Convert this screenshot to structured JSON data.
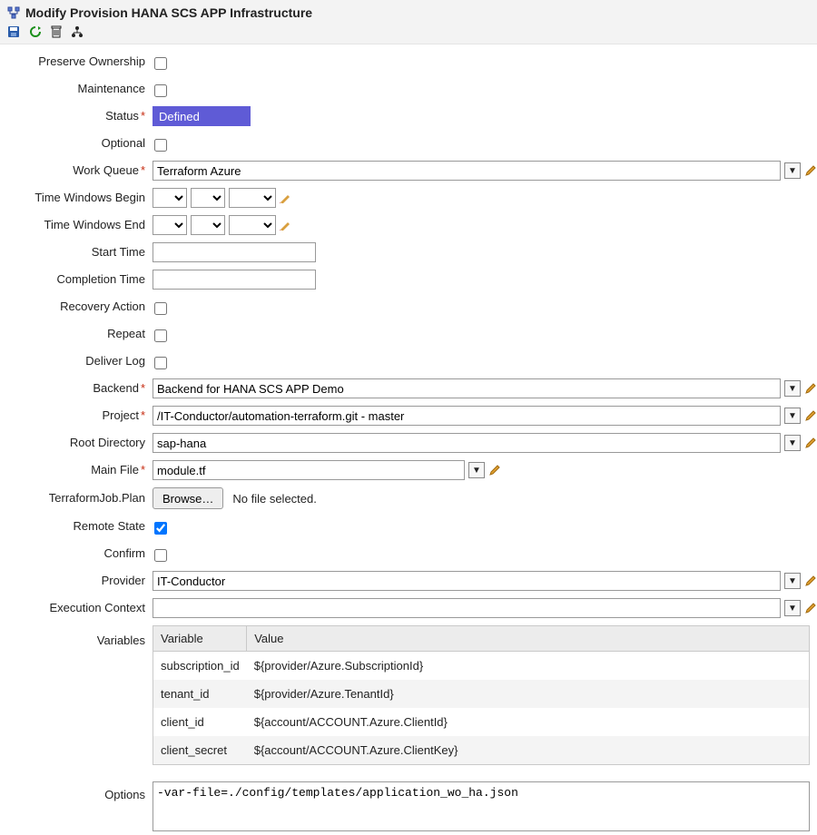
{
  "header": {
    "title": "Modify Provision HANA SCS APP Infrastructure"
  },
  "fields": {
    "preserve_ownership_label": "Preserve Ownership",
    "maintenance_label": "Maintenance",
    "status_label": "Status",
    "status_value": "Defined",
    "optional_label": "Optional",
    "work_queue_label": "Work Queue",
    "work_queue_value": "Terraform Azure",
    "tw_begin_label": "Time Windows Begin",
    "tw_end_label": "Time Windows End",
    "start_time_label": "Start Time",
    "completion_time_label": "Completion Time",
    "recovery_action_label": "Recovery Action",
    "repeat_label": "Repeat",
    "deliver_log_label": "Deliver Log",
    "backend_label": "Backend",
    "backend_value": "Backend for HANA SCS APP Demo",
    "project_label": "Project",
    "project_value": "/IT-Conductor/automation-terraform.git - master",
    "root_dir_label": "Root Directory",
    "root_dir_value": "sap-hana",
    "main_file_label": "Main File",
    "main_file_value": "module.tf",
    "tf_plan_label": "TerraformJob.Plan",
    "browse_label": "Browse…",
    "no_file_text": "No file selected.",
    "remote_state_label": "Remote State",
    "confirm_label": "Confirm",
    "provider_label": "Provider",
    "provider_value": "IT-Conductor",
    "exec_ctx_label": "Execution Context",
    "variables_label": "Variables",
    "options_label": "Options",
    "options_value": "-var-file=./config/templates/application_wo_ha.json"
  },
  "vars_table": {
    "col_variable": "Variable",
    "col_value": "Value",
    "rows": [
      {
        "name": "subscription_id",
        "value": "${provider/Azure.SubscriptionId}"
      },
      {
        "name": "tenant_id",
        "value": "${provider/Azure.TenantId}"
      },
      {
        "name": "client_id",
        "value": "${account/ACCOUNT.Azure.ClientId}"
      },
      {
        "name": "client_secret",
        "value": "${account/ACCOUNT.Azure.ClientKey}"
      }
    ]
  }
}
